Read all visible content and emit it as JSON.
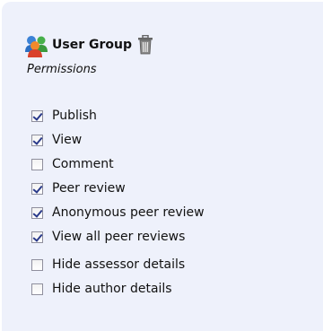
{
  "group": {
    "title": "User Group",
    "subtitle": "Permissions",
    "icon": "user-group-icon",
    "delete_icon": "trash-icon"
  },
  "permissions": [
    {
      "label": "Publish",
      "checked": true
    },
    {
      "label": "View",
      "checked": true
    },
    {
      "label": "Comment",
      "checked": false
    },
    {
      "label": "Peer review",
      "checked": true
    },
    {
      "label": "Anonymous peer review",
      "checked": true
    },
    {
      "label": "View all peer reviews",
      "checked": true
    },
    {
      "label": "Hide assessor details",
      "checked": false
    },
    {
      "label": "Hide author details",
      "checked": false
    }
  ],
  "colors": {
    "panel_bg": "#eef1fb",
    "check": "#2a3a8a"
  }
}
